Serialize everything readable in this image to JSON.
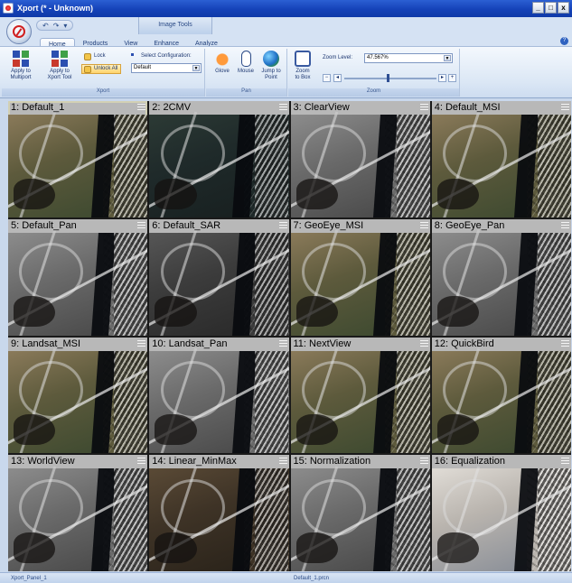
{
  "window": {
    "title": "Xport (* - Unknown)",
    "buttons": [
      "_",
      "□",
      "x"
    ]
  },
  "quick_access": {
    "items": [
      "↶",
      "↷",
      "▾"
    ]
  },
  "context_tab_header": "Image Tools",
  "tabs": [
    "Home",
    "Products",
    "View",
    "Enhance",
    "Analyze"
  ],
  "active_tab": "Home",
  "ribbon": {
    "xport_group": {
      "label": "Xport",
      "apply_multiport": [
        "Apply to",
        "Multiport"
      ],
      "apply_xport_tool": [
        "Apply to",
        "Xport Tool"
      ],
      "lock": "Lock",
      "unlock_all": "Unlock All",
      "select_configuration_label": "Select Configuration:",
      "configuration_value": "Default"
    },
    "pan_group": {
      "label": "Pan",
      "glove": "Glove",
      "mouse": "Mouse",
      "jump_to_point": [
        "Jump to",
        "Point"
      ]
    },
    "zoom_group": {
      "label": "Zoom",
      "zoom_to_box": [
        "Zoom",
        "to Box"
      ],
      "zoom_level_label": "Zoom Level:",
      "zoom_level_value": "47.567%",
      "slider_fraction": 0.47
    }
  },
  "tiles": [
    {
      "label": "1: Default_1",
      "tone": "natural",
      "selected": true
    },
    {
      "label": "2: 2CMV",
      "tone": "dark",
      "selected": false
    },
    {
      "label": "3: ClearView",
      "tone": "gray",
      "selected": false
    },
    {
      "label": "4: Default_MSI",
      "tone": "natural",
      "selected": false
    },
    {
      "label": "5: Default_Pan",
      "tone": "gray",
      "selected": false
    },
    {
      "label": "6: Default_SAR",
      "tone": "darkgray",
      "selected": false
    },
    {
      "label": "7: GeoEye_MSI",
      "tone": "natural",
      "selected": false
    },
    {
      "label": "8: GeoEye_Pan",
      "tone": "gray",
      "selected": false
    },
    {
      "label": "9: Landsat_MSI",
      "tone": "natural",
      "selected": false
    },
    {
      "label": "10: Landsat_Pan",
      "tone": "gray",
      "selected": false
    },
    {
      "label": "11: NextView",
      "tone": "natural",
      "selected": false
    },
    {
      "label": "12: QuickBird",
      "tone": "natural",
      "selected": false
    },
    {
      "label": "13: WorldView",
      "tone": "gray",
      "selected": false
    },
    {
      "label": "14: Linear_MinMax",
      "tone": "brown",
      "selected": false
    },
    {
      "label": "15: Normalization",
      "tone": "gray",
      "selected": false
    },
    {
      "label": "16: Equalization",
      "tone": "bright",
      "selected": false
    }
  ],
  "tone_colors": {
    "natural": [
      "#5d5a3c",
      "#8a7a5a",
      "#3e4a30"
    ],
    "dark": [
      "#1f2a2a",
      "#2c3a35",
      "#182020"
    ],
    "gray": [
      "#6a6a6a",
      "#8c8c8c",
      "#4a4a4a"
    ],
    "darkgray": [
      "#3c3c3c",
      "#565656",
      "#2a2a2a"
    ],
    "brown": [
      "#3e3326",
      "#5a4a36",
      "#2a231a"
    ],
    "bright": [
      "#b9b4ae",
      "#e0dcd6",
      "#8a8f98"
    ]
  },
  "status": {
    "left": "Xport_Panel_1",
    "middle": "Default_1.prcn"
  }
}
